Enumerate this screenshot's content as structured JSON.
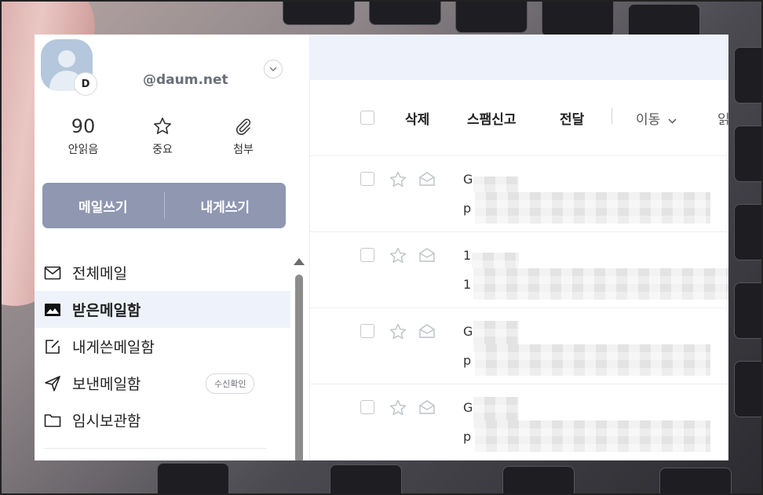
{
  "account": {
    "avatar_badge": "D",
    "email": "@daum.net"
  },
  "stats": [
    {
      "value": "90",
      "label": "안읽음"
    },
    {
      "icon": "star-icon",
      "label": "중요"
    },
    {
      "icon": "paperclip-icon",
      "label": "첨부"
    }
  ],
  "compose": {
    "write_mail": "메일쓰기",
    "write_to_me": "내게쓰기"
  },
  "nav": {
    "items": [
      {
        "icon": "envelope-icon",
        "label": "전체메일"
      },
      {
        "icon": "inbox-icon",
        "label": "받은메일함"
      },
      {
        "icon": "note-edit-icon",
        "label": "내게쓴메일함"
      },
      {
        "icon": "send-icon",
        "label": "보낸메일함",
        "badge": "수신확인"
      },
      {
        "icon": "folder-icon",
        "label": "임시보관함"
      }
    ]
  },
  "toolbar": {
    "delete": "삭제",
    "spam": "스팸신고",
    "forward": "전달",
    "move": "이동",
    "more": "읽"
  },
  "mails": [
    {
      "sender": "G",
      "subject": "p"
    },
    {
      "sender": "1",
      "subject": "1"
    },
    {
      "sender": "G",
      "subject": "p"
    },
    {
      "sender": "G",
      "subject": "p"
    }
  ],
  "colors": {
    "accent": "#8f97b1",
    "active_bg": "#eef3fb"
  }
}
